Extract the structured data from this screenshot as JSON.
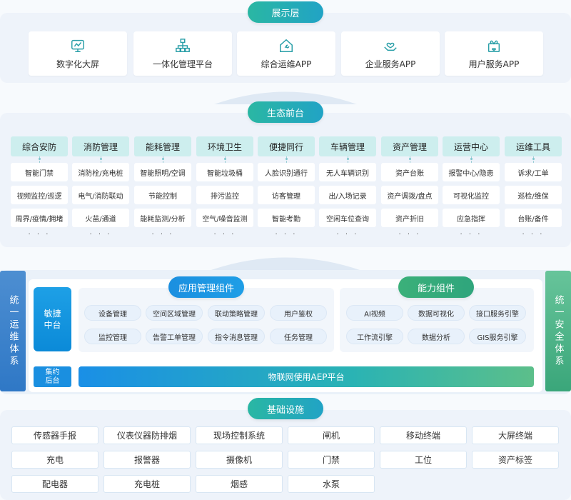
{
  "display_layer": {
    "title": "展示层",
    "items": [
      {
        "label": "数字化大屏",
        "icon": "monitor-icon"
      },
      {
        "label": "一体化管理平台",
        "icon": "org-chart-icon"
      },
      {
        "label": "综合运维APP",
        "icon": "house-wrench-icon"
      },
      {
        "label": "企业服务APP",
        "icon": "hand-heart-icon"
      },
      {
        "label": "用户服务APP",
        "icon": "gift-heart-icon"
      }
    ]
  },
  "eco_frontend": {
    "title": "生态前台",
    "columns": [
      {
        "header": "综合安防",
        "items": [
          "智能门禁",
          "视频监控/巡逻",
          "周界/疫情/拥堵"
        ],
        "more": "· · ·"
      },
      {
        "header": "消防管理",
        "items": [
          "消防栓/充电桩",
          "电气/消防联动",
          "火苗/通道"
        ],
        "more": "· · ·"
      },
      {
        "header": "能耗管理",
        "items": [
          "智能照明/空调",
          "节能控制",
          "能耗监测/分析"
        ],
        "more": "· · ·"
      },
      {
        "header": "环境卫生",
        "items": [
          "智能垃圾桶",
          "排污监控",
          "空气/噪音监测"
        ],
        "more": "· · ·"
      },
      {
        "header": "便捷同行",
        "items": [
          "人脸识别通行",
          "访客管理",
          "智能考勤"
        ],
        "more": "· · ·"
      },
      {
        "header": "车辆管理",
        "items": [
          "无人车辆识别",
          "出/入场记录",
          "空闲车位查询"
        ],
        "more": "· · ·"
      },
      {
        "header": "资产管理",
        "items": [
          "资产台账",
          "资产调拨/盘点",
          "资产折旧"
        ],
        "more": "· · ·"
      },
      {
        "header": "运营中心",
        "items": [
          "报警中心/隐患",
          "可视化监控",
          "应急指挥"
        ],
        "more": "· · ·"
      },
      {
        "header": "运维工具",
        "items": [
          "诉求/工单",
          "巡检/维保",
          "台账/备件"
        ],
        "more": "· · ·"
      }
    ]
  },
  "middle": {
    "left_side": "统一运维体系",
    "right_side": "统一安全体系",
    "agile_label": "敏捷中台",
    "backend_label": "集约后台",
    "app_mgmt": {
      "title": "应用管理组件",
      "items": [
        "设备管理",
        "空间区域管理",
        "联动策略管理",
        "用户鉴权",
        "监控管理",
        "告警工单管理",
        "指令消息管理",
        "任务管理"
      ]
    },
    "capability": {
      "title": "能力组件",
      "items": [
        "AI视频",
        "数据可视化",
        "接口服务引擎",
        "工作流引擎",
        "数据分析",
        "GIS服务引擎"
      ]
    },
    "aep_label": "物联网使用AEP平台"
  },
  "infrastructure": {
    "title": "基础设施",
    "items": [
      "传感器手报",
      "仪表仪器防排烟",
      "现场控制系统",
      "闸机",
      "移动终端",
      "大屏终端",
      "充电",
      "报警器",
      "摄像机",
      "门禁",
      "工位",
      "资产标签",
      "配电器",
      "充电桩",
      "烟感",
      "水泵"
    ]
  }
}
